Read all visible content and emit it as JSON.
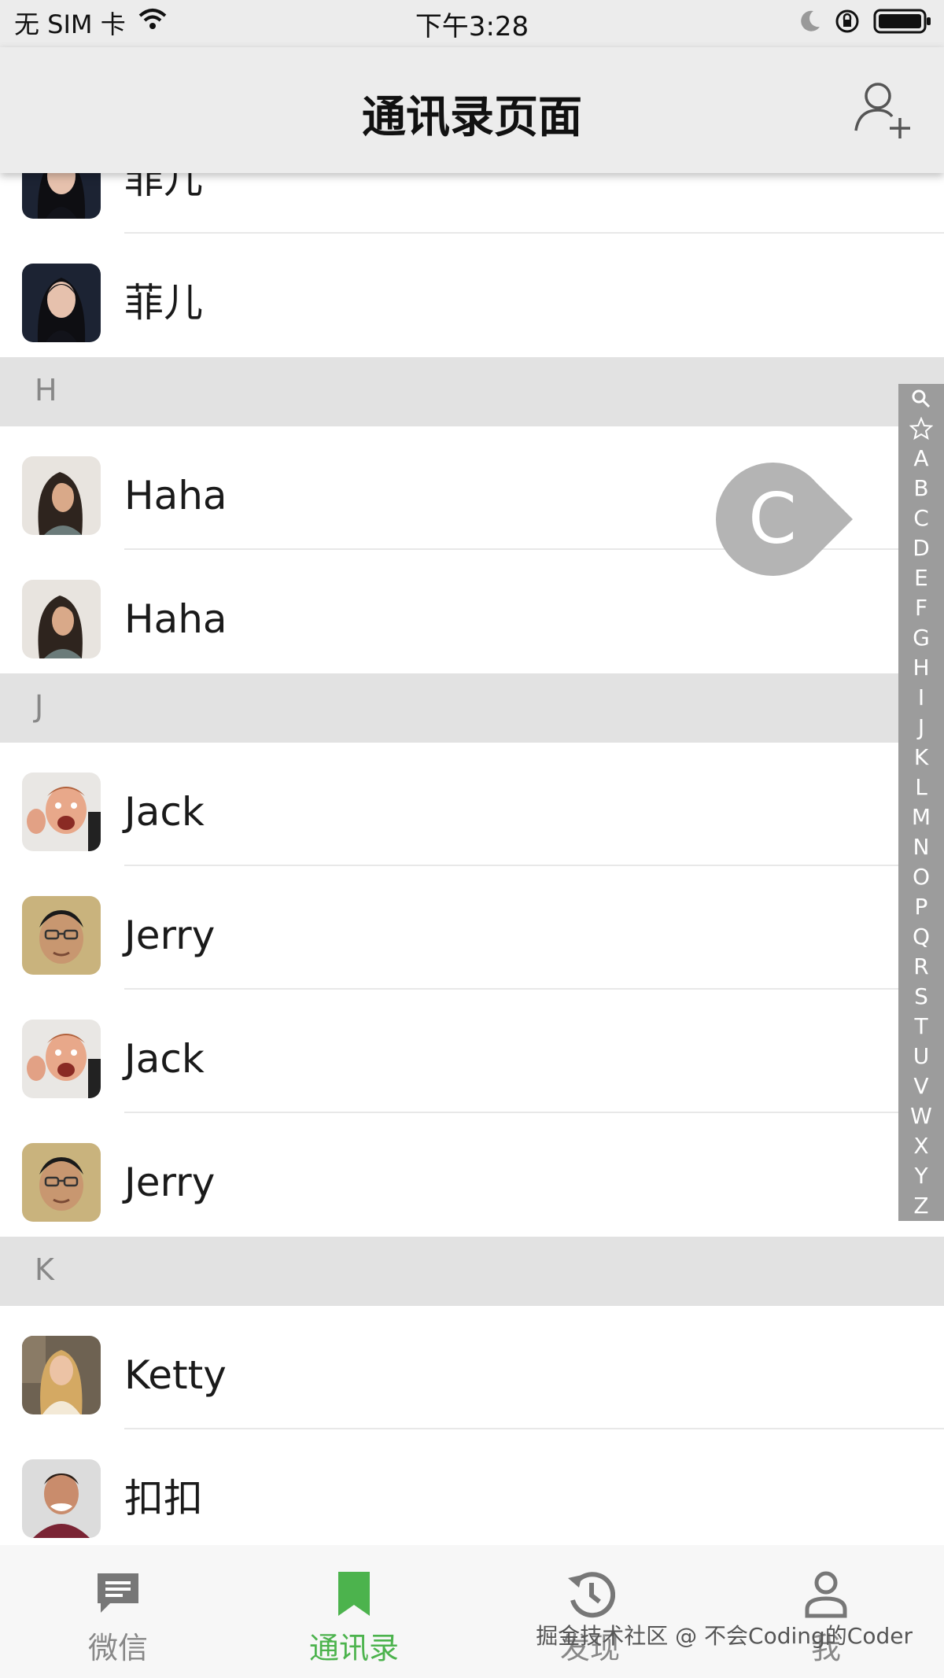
{
  "status_bar": {
    "carrier": "无 SIM 卡",
    "time": "下午3:28"
  },
  "nav": {
    "title": "通讯录页面"
  },
  "sections": [
    {
      "header": "",
      "contacts": [
        {
          "name": "菲儿",
          "avatar": "feier"
        },
        {
          "name": "菲儿",
          "avatar": "feier"
        }
      ]
    },
    {
      "header": "H",
      "contacts": [
        {
          "name": "Haha",
          "avatar": "haha"
        },
        {
          "name": "Haha",
          "avatar": "haha"
        }
      ]
    },
    {
      "header": "J",
      "contacts": [
        {
          "name": "Jack",
          "avatar": "jack"
        },
        {
          "name": "Jerry",
          "avatar": "jerry"
        },
        {
          "name": "Jack",
          "avatar": "jack"
        },
        {
          "name": "Jerry",
          "avatar": "jerry"
        }
      ]
    },
    {
      "header": "K",
      "contacts": [
        {
          "name": "Ketty",
          "avatar": "ketty"
        },
        {
          "name": "扣扣",
          "avatar": "koukou"
        }
      ]
    }
  ],
  "index_bar": [
    "search-icon",
    "star-icon",
    "A",
    "B",
    "C",
    "D",
    "E",
    "F",
    "G",
    "H",
    "I",
    "J",
    "K",
    "L",
    "M",
    "N",
    "O",
    "P",
    "Q",
    "R",
    "S",
    "T",
    "U",
    "V",
    "W",
    "X",
    "Y",
    "Z"
  ],
  "index_indicator": {
    "letter": "C"
  },
  "tabs": [
    {
      "label": "微信",
      "icon": "chat-icon",
      "active": false
    },
    {
      "label": "通讯录",
      "icon": "contacts-icon",
      "active": true
    },
    {
      "label": "发现",
      "icon": "history-icon",
      "active": false
    },
    {
      "label": "我",
      "icon": "person-icon",
      "active": false
    }
  ],
  "watermark": "掘金技术社区 @ 不会Coding的Coder",
  "colors": {
    "accent": "#4cb34d",
    "inactive": "#888888",
    "index_bar": "#9c9c9c",
    "section_header": "#e2e2e2",
    "nav_bg": "#ececec"
  }
}
